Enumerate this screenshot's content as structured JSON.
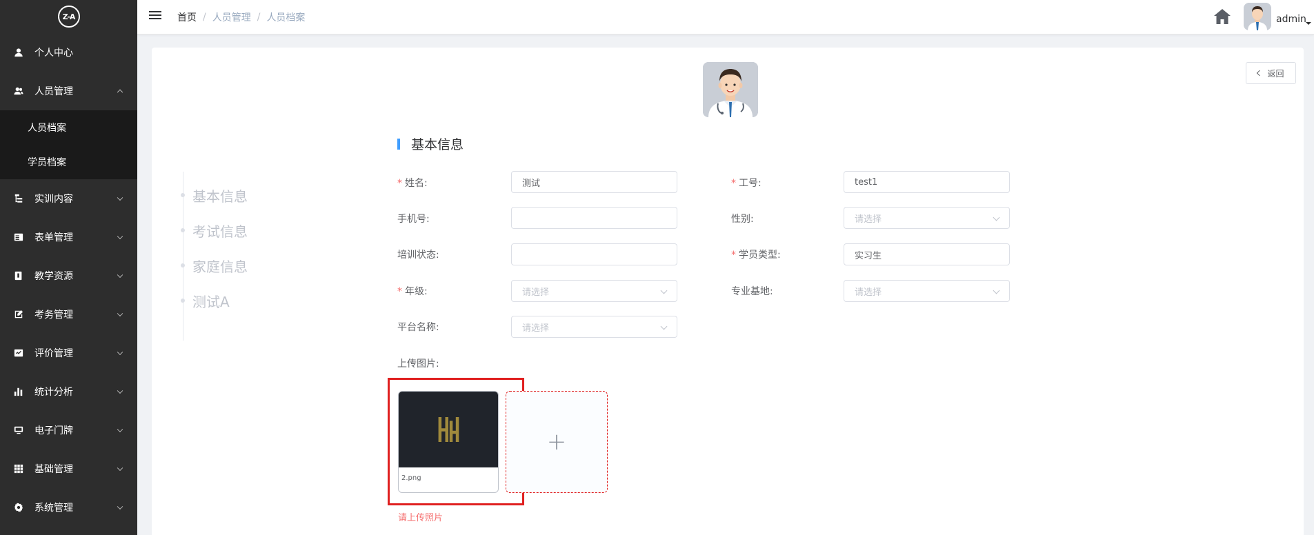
{
  "logo": {
    "text": "Z-A"
  },
  "sidebar": {
    "items": [
      {
        "label": "个人中心"
      },
      {
        "label": "人员管理"
      },
      {
        "label": "实训内容"
      },
      {
        "label": "表单管理"
      },
      {
        "label": "教学资源"
      },
      {
        "label": "考务管理"
      },
      {
        "label": "评价管理"
      },
      {
        "label": "统计分析"
      },
      {
        "label": "电子门牌"
      },
      {
        "label": "基础管理"
      },
      {
        "label": "系统管理"
      }
    ],
    "submenu": [
      {
        "label": "人员档案"
      },
      {
        "label": "学员档案"
      }
    ]
  },
  "header": {
    "breadcrumb": [
      "首页",
      "人员管理",
      "人员档案"
    ],
    "breadcrumb_sep": "/",
    "username": "admin"
  },
  "card": {
    "back_label": "返回",
    "timeline": [
      "基本信息",
      "考试信息",
      "家庭信息",
      "测试A"
    ],
    "section_title": "基本信息",
    "form": {
      "name": {
        "label": "姓名:",
        "value": "测试",
        "required": "*"
      },
      "job_no": {
        "label": "工号:",
        "value": "test1",
        "required": "*"
      },
      "phone": {
        "label": "手机号:",
        "value": ""
      },
      "gender": {
        "label": "性别:",
        "placeholder": "请选择"
      },
      "train_status": {
        "label": "培训状态:",
        "value": ""
      },
      "student_type": {
        "label": "学员类型:",
        "value": "实习生",
        "required": "*"
      },
      "grade": {
        "label": "年级:",
        "placeholder": "请选择",
        "required": "*"
      },
      "base": {
        "label": "专业基地:",
        "placeholder": "请选择"
      },
      "platform": {
        "label": "平台名称:",
        "placeholder": "请选择"
      },
      "upload": {
        "label": "上传图片:",
        "file_name": "2.png",
        "plus": "+",
        "error": "请上传照片"
      }
    }
  },
  "colors": {
    "sidebar_bg": "#2d2d2d",
    "submenu_bg": "#1a1a1a",
    "accent": "#409eff",
    "required": "#f56c6c",
    "highlight": "#e02020"
  }
}
